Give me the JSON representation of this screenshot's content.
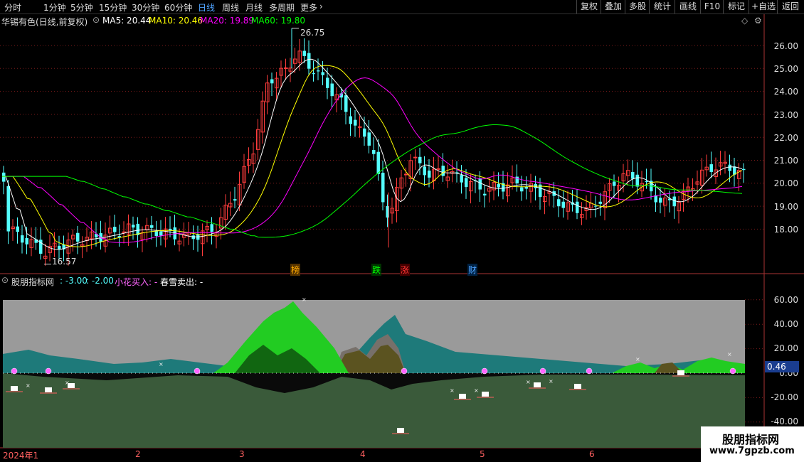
{
  "toolbar": {
    "left_tabs": [
      "分时",
      "1分钟",
      "5分钟",
      "15分钟",
      "30分钟",
      "60分钟",
      "日线",
      "周线",
      "月线",
      "多周期",
      "更多"
    ],
    "active_tab": "日线",
    "right_buttons": [
      "复权",
      "叠加",
      "多股",
      "统计",
      "画线",
      "F10",
      "标记",
      "+自选",
      "返回"
    ]
  },
  "main_chart": {
    "title": "华锡有色(日线,前复权)",
    "ma_labels": [
      {
        "text": "MA5: 20.44",
        "color": "#ffffff"
      },
      {
        "text": "MA10: 20.46",
        "color": "#ffff00"
      },
      {
        "text": "MA20: 19.89",
        "color": "#ff00ff"
      },
      {
        "text": "MA60: 19.80",
        "color": "#00ff00"
      }
    ],
    "y_ticks": [
      "26.00",
      "25.00",
      "24.00",
      "23.00",
      "22.00",
      "21.00",
      "20.00",
      "19.00",
      "18.00"
    ],
    "high_label": "26.75",
    "low_label": "16.57",
    "event_tags": [
      {
        "text": "榜",
        "color": "#ffaa00"
      },
      {
        "text": "跌",
        "color": "#00ff00"
      },
      {
        "text": "涨",
        "color": "#ff3333"
      },
      {
        "text": "财",
        "color": "#4fa3ff"
      }
    ]
  },
  "indicator": {
    "name": "股朋指标网",
    "v1": ": -3.00",
    "v2": ": -2.00",
    "buy_label": "小花买入: -",
    "sell_label": "春雪卖出: -",
    "y_ticks": [
      "60.00",
      "40.00",
      "20.00",
      "0.00",
      "-20.00",
      "-40.00"
    ],
    "current_value": "0.46"
  },
  "x_axis": {
    "labels": [
      "2024年1",
      "2",
      "3",
      "4",
      "5",
      "6"
    ]
  },
  "watermark": {
    "line1": "股朋指标网",
    "line2": "www.7gpzb.com"
  },
  "colors": {
    "up": "#ff3c3c",
    "down": "#54ffff",
    "ma5": "#ffffff",
    "ma10": "#ffff00",
    "ma20": "#ff00ff",
    "ma60": "#00ff00",
    "accent_blue": "#4fa3ff"
  }
}
